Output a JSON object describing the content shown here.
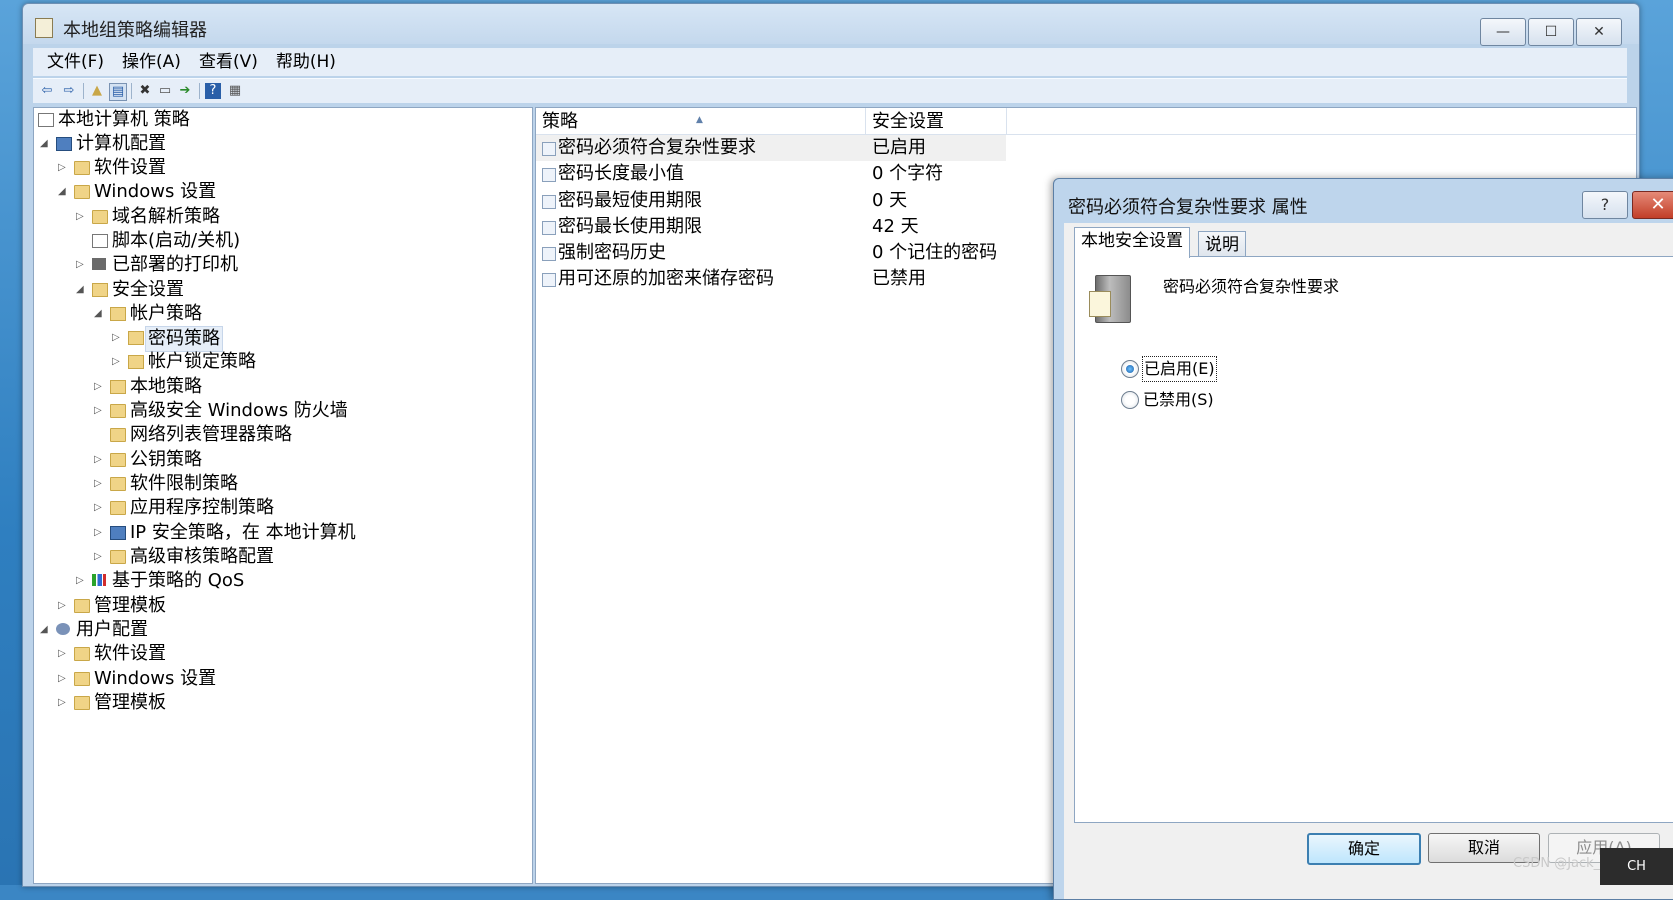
{
  "window": {
    "title": "本地组策略编辑器",
    "min_glyph": "—",
    "max_glyph": "☐",
    "close_glyph": "✕"
  },
  "menu": [
    "文件(F)",
    "操作(A)",
    "查看(V)",
    "帮助(H)"
  ],
  "toolbar": {
    "icons": [
      "back-arrow-icon",
      "forward-arrow-icon",
      "up-folder-icon",
      "show-hide-tree-icon",
      "delete-icon",
      "properties-icon",
      "export-list-icon",
      "help-icon",
      "view-icon"
    ]
  },
  "tree": {
    "root": "本地计算机 策略",
    "computer_config": "计算机配置",
    "cc_software": "软件设置",
    "cc_windows": "Windows 设置",
    "dns": "域名解析策略",
    "scripts": "脚本(启动/关机)",
    "printers": "已部署的打印机",
    "security": "安全设置",
    "account": "帐户策略",
    "password": "密码策略",
    "lockout": "帐户锁定策略",
    "local": "本地策略",
    "firewall": "高级安全 Windows 防火墙",
    "netlist": "网络列表管理器策略",
    "pubkey": "公钥策略",
    "swrestrict": "软件限制策略",
    "appcontrol": "应用程序控制策略",
    "ipsec": "IP 安全策略，在 本地计算机",
    "audit": "高级审核策略配置",
    "qos": "基于策略的 QoS",
    "cc_admin": "管理模板",
    "user_config": "用户配置",
    "uc_software": "软件设置",
    "uc_windows": "Windows 设置",
    "uc_admin": "管理模板"
  },
  "list": {
    "col_policy": "策略",
    "col_setting": "安全设置",
    "rows": [
      {
        "policy": "密码必须符合复杂性要求",
        "setting": "已启用"
      },
      {
        "policy": "密码长度最小值",
        "setting": "0 个字符"
      },
      {
        "policy": "密码最短使用期限",
        "setting": "0 天"
      },
      {
        "policy": "密码最长使用期限",
        "setting": "42 天"
      },
      {
        "policy": "强制密码历史",
        "setting": "0 个记住的密码"
      },
      {
        "policy": "用可还原的加密来储存密码",
        "setting": "已禁用"
      }
    ]
  },
  "dialog": {
    "title": "密码必须符合复杂性要求 属性",
    "help_glyph": "?",
    "close_glyph": "✕",
    "tab_local": "本地安全设置",
    "tab_explain": "说明",
    "policy_name": "密码必须符合复杂性要求",
    "enabled_label": "已启用(E)",
    "disabled_label": "已禁用(S)",
    "selected": "enabled",
    "ok": "确定",
    "cancel": "取消",
    "apply": "应用(A)"
  },
  "watermark": "CSDN @Jack_chen_",
  "ime": "CH"
}
